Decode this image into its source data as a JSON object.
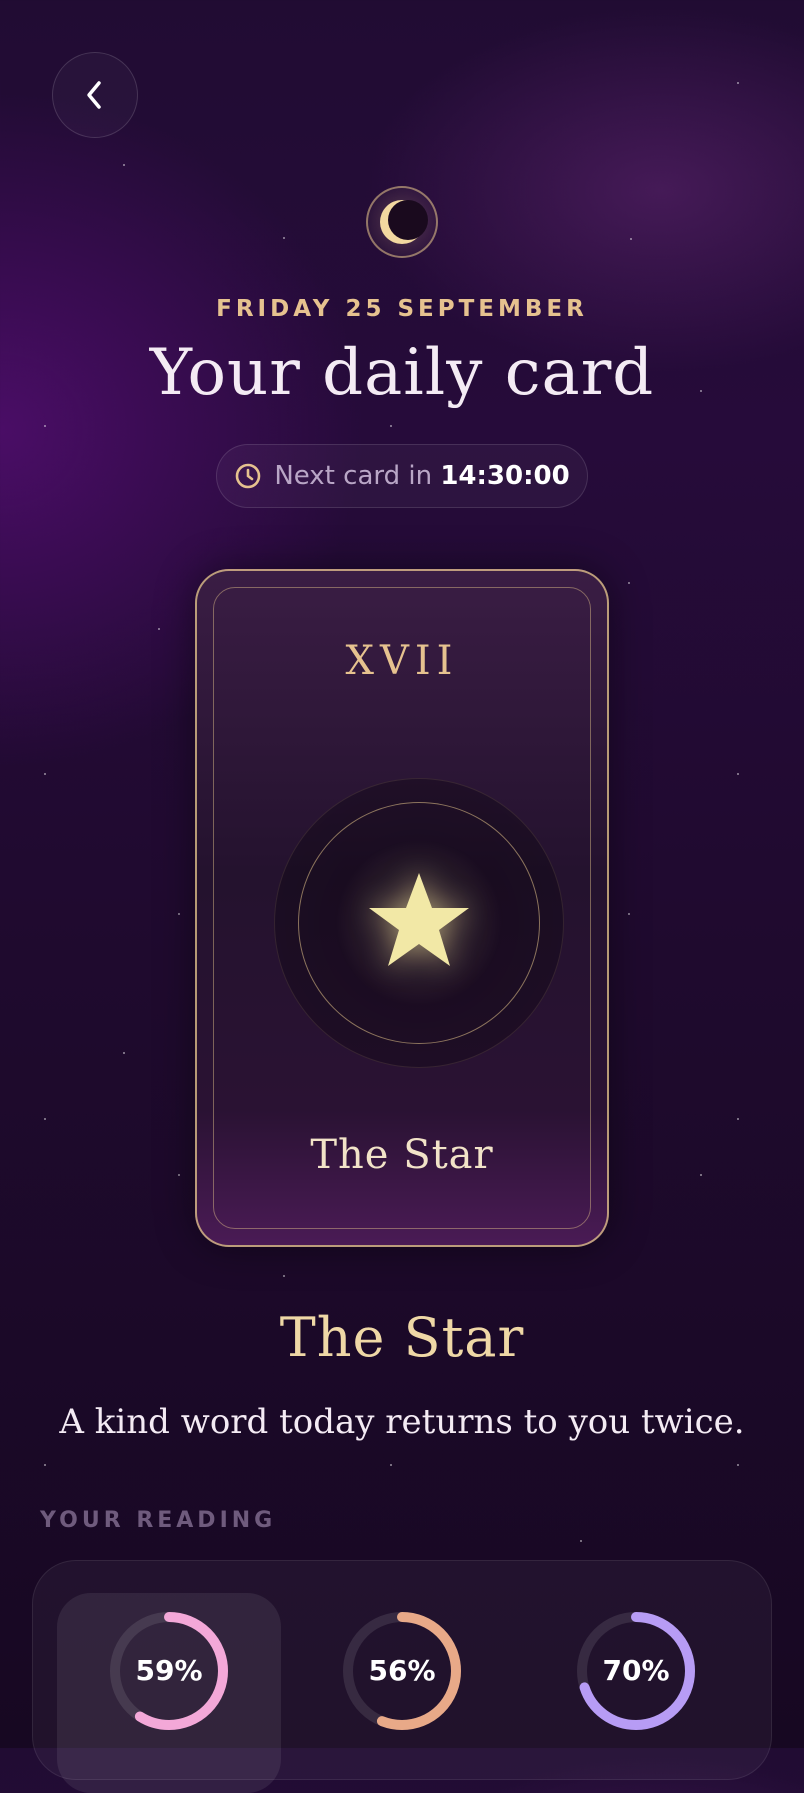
{
  "header": {
    "date": "FRIDAY 25 SEPTEMBER",
    "title": "Your daily card",
    "timer_prefix": "Next card in",
    "timer_value": "14:30:00"
  },
  "card": {
    "numeral": "XVII",
    "name": "The Star",
    "icon": "star-icon"
  },
  "reading": {
    "heading": "The Star",
    "message": "A kind word today returns to you twice.",
    "section_label": "YOUR READING",
    "metrics": [
      {
        "label": "59%",
        "value": 0.59,
        "color": "#f3a8d8"
      },
      {
        "label": "56%",
        "value": 0.56,
        "color": "#e8a988"
      },
      {
        "label": "70%",
        "value": 0.7,
        "color": "#b79cf5"
      }
    ]
  },
  "icons": {
    "back": "chevron-left-icon",
    "moon": "moon-icon",
    "timer": "clock-icon"
  },
  "colors": {
    "accent_gold": "#e6c28f",
    "star_fill": "#f2e8a6",
    "background": "#210c33"
  }
}
